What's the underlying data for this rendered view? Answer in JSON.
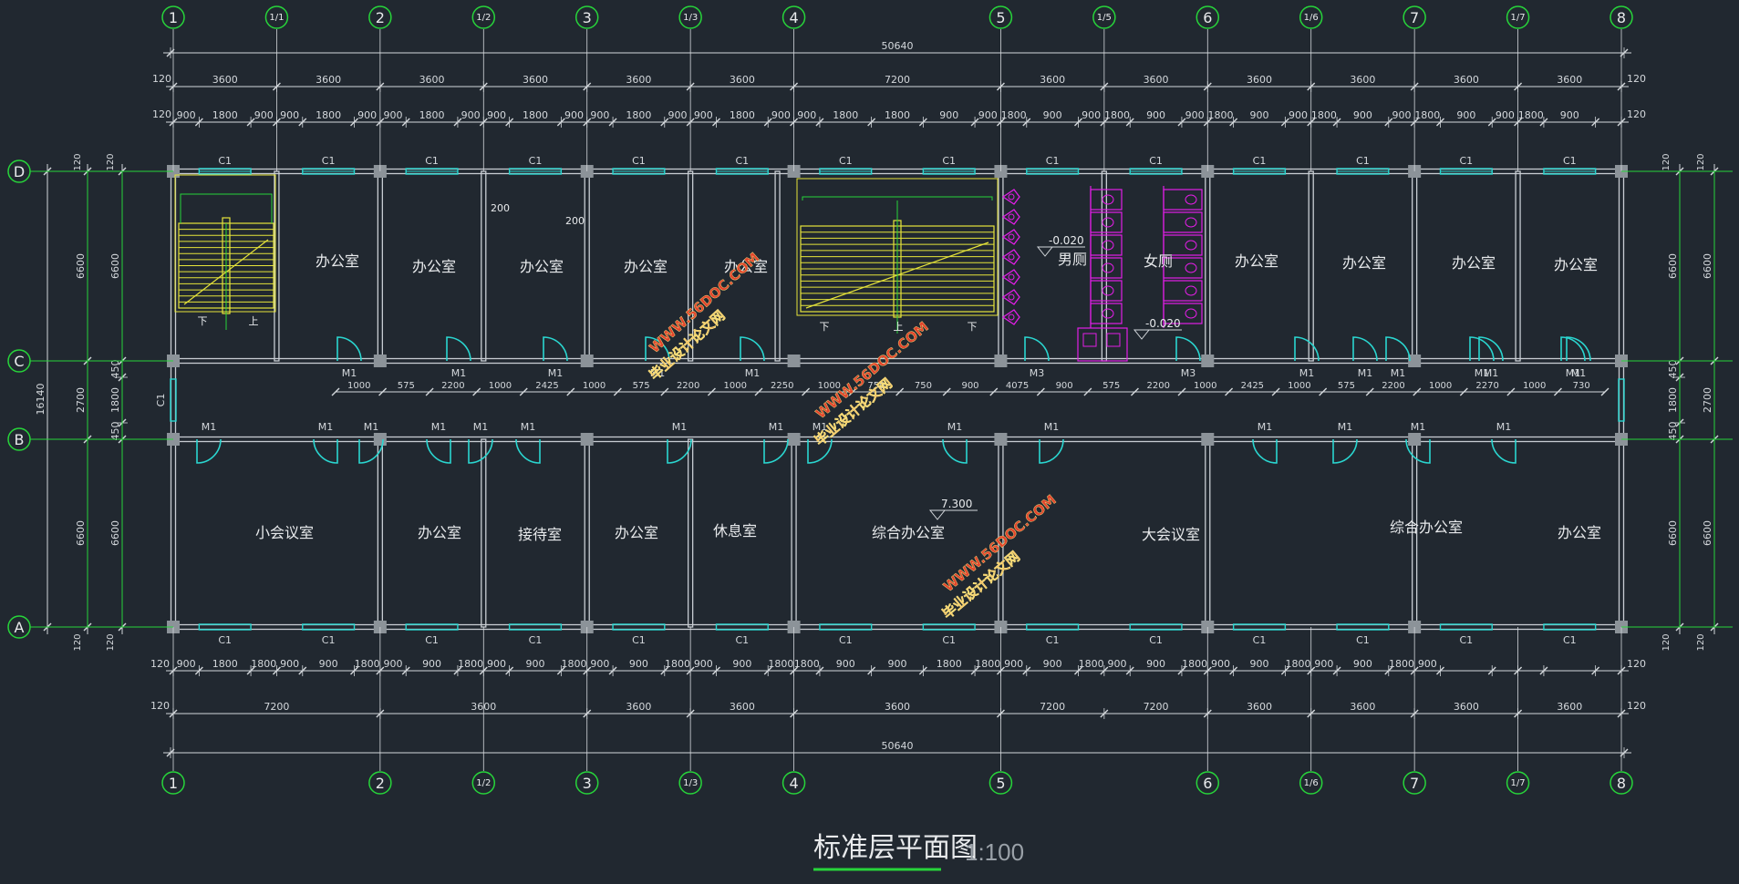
{
  "title": "标准层平面图",
  "scale": "1:100",
  "watermark": "WWW.56DOC.COM",
  "watermark_cn": "毕业设计论文网",
  "colors": {
    "background": "#212830",
    "wall": "#c7ccd2",
    "dim": "#d4d8dc",
    "axis": "#27d43a",
    "window": "#2ad6d0",
    "stair": "#e6e43a",
    "fixture": "#e21ee6",
    "watermark": "#e3432d",
    "text": "#e8eaec"
  },
  "axes_x": [
    "1",
    "1/1",
    "2",
    "1/2",
    "3",
    "1/3",
    "4",
    "5",
    "1/5",
    "6",
    "1/6",
    "7",
    "1/7",
    "8"
  ],
  "axes_x_bottom": [
    "1",
    "2",
    "1/2",
    "3",
    "1/3",
    "4",
    "5",
    "6",
    "1/6",
    "7",
    "1/7",
    "8"
  ],
  "axes_y": [
    "D",
    "C",
    "B",
    "A"
  ],
  "top_dims": {
    "total": "50640",
    "bays": [
      "3600",
      "3600",
      "3600",
      "3600",
      "3600",
      "3600",
      "7200",
      "3600",
      "3600",
      "3600",
      "3600",
      "3600",
      "3600"
    ],
    "edge": "120",
    "win_top": [
      "900",
      "1800",
      "900",
      "900",
      "1800",
      "900",
      "900",
      "1800",
      "900",
      "900",
      "1800",
      "900",
      "900",
      "1800",
      "900",
      "900",
      "1800",
      "900",
      "900",
      "1800",
      "1800",
      "900",
      "900",
      "1800",
      "900",
      "900",
      "1800",
      "900",
      "900",
      "1800",
      "900",
      "900",
      "1800",
      "900",
      "900",
      "1800",
      "900",
      "900",
      "1800",
      "900"
    ]
  },
  "bottom_dims": {
    "total": "50640",
    "bays": [
      "7200",
      "3600",
      "3600",
      "3600",
      "3600",
      "7200",
      "7200",
      "3600",
      "3600",
      "3600",
      "3600"
    ],
    "edge": "120",
    "win_bottom": [
      "900",
      "1800",
      "1800",
      "900",
      "900",
      "1800",
      "900",
      "900",
      "1800",
      "900",
      "900",
      "1800",
      "900",
      "900",
      "1800",
      "900",
      "900",
      "1800",
      "1800",
      "900",
      "900",
      "1800",
      "1800",
      "900",
      "900",
      "1800",
      "900",
      "900",
      "1800",
      "900",
      "900",
      "1800",
      "900",
      "900",
      "1800",
      "900"
    ]
  },
  "side_dims": {
    "total": "16140",
    "bays": [
      "6600",
      "2700",
      "6600"
    ],
    "inner": [
      "6600",
      "450",
      "1800",
      "450",
      "6600"
    ],
    "edge": "120"
  },
  "corridor_top_dims": [
    "1000",
    "575",
    "2200",
    "1000",
    "2425",
    "1000",
    "575",
    "2200",
    "1000",
    "2250",
    "1000",
    "750",
    "750",
    "900",
    "4075",
    "900",
    "575",
    "2200",
    "1000",
    "2425",
    "1000",
    "575",
    "2200",
    "1000",
    "2270",
    "1000",
    "730"
  ],
  "window_label": "C1",
  "door_label": "M1",
  "door_label_wc": "M3",
  "rooms_north": [
    "办公室",
    "办公室",
    "办公室",
    "办公室",
    "办公室",
    "男厕",
    "女厕",
    "办公室",
    "办公室",
    "办公室",
    "办公室"
  ],
  "rooms_south": [
    "小会议室",
    "办公室",
    "接待室",
    "办公室",
    "休息室",
    "综合办公室",
    "大会议室",
    "综合办公室",
    "办公室"
  ],
  "stair_labels": [
    "下",
    "上",
    "下",
    "上",
    "下"
  ],
  "elevations": [
    "-0.020",
    "-0.020",
    "7.300"
  ],
  "small_dims": [
    "200",
    "200"
  ]
}
